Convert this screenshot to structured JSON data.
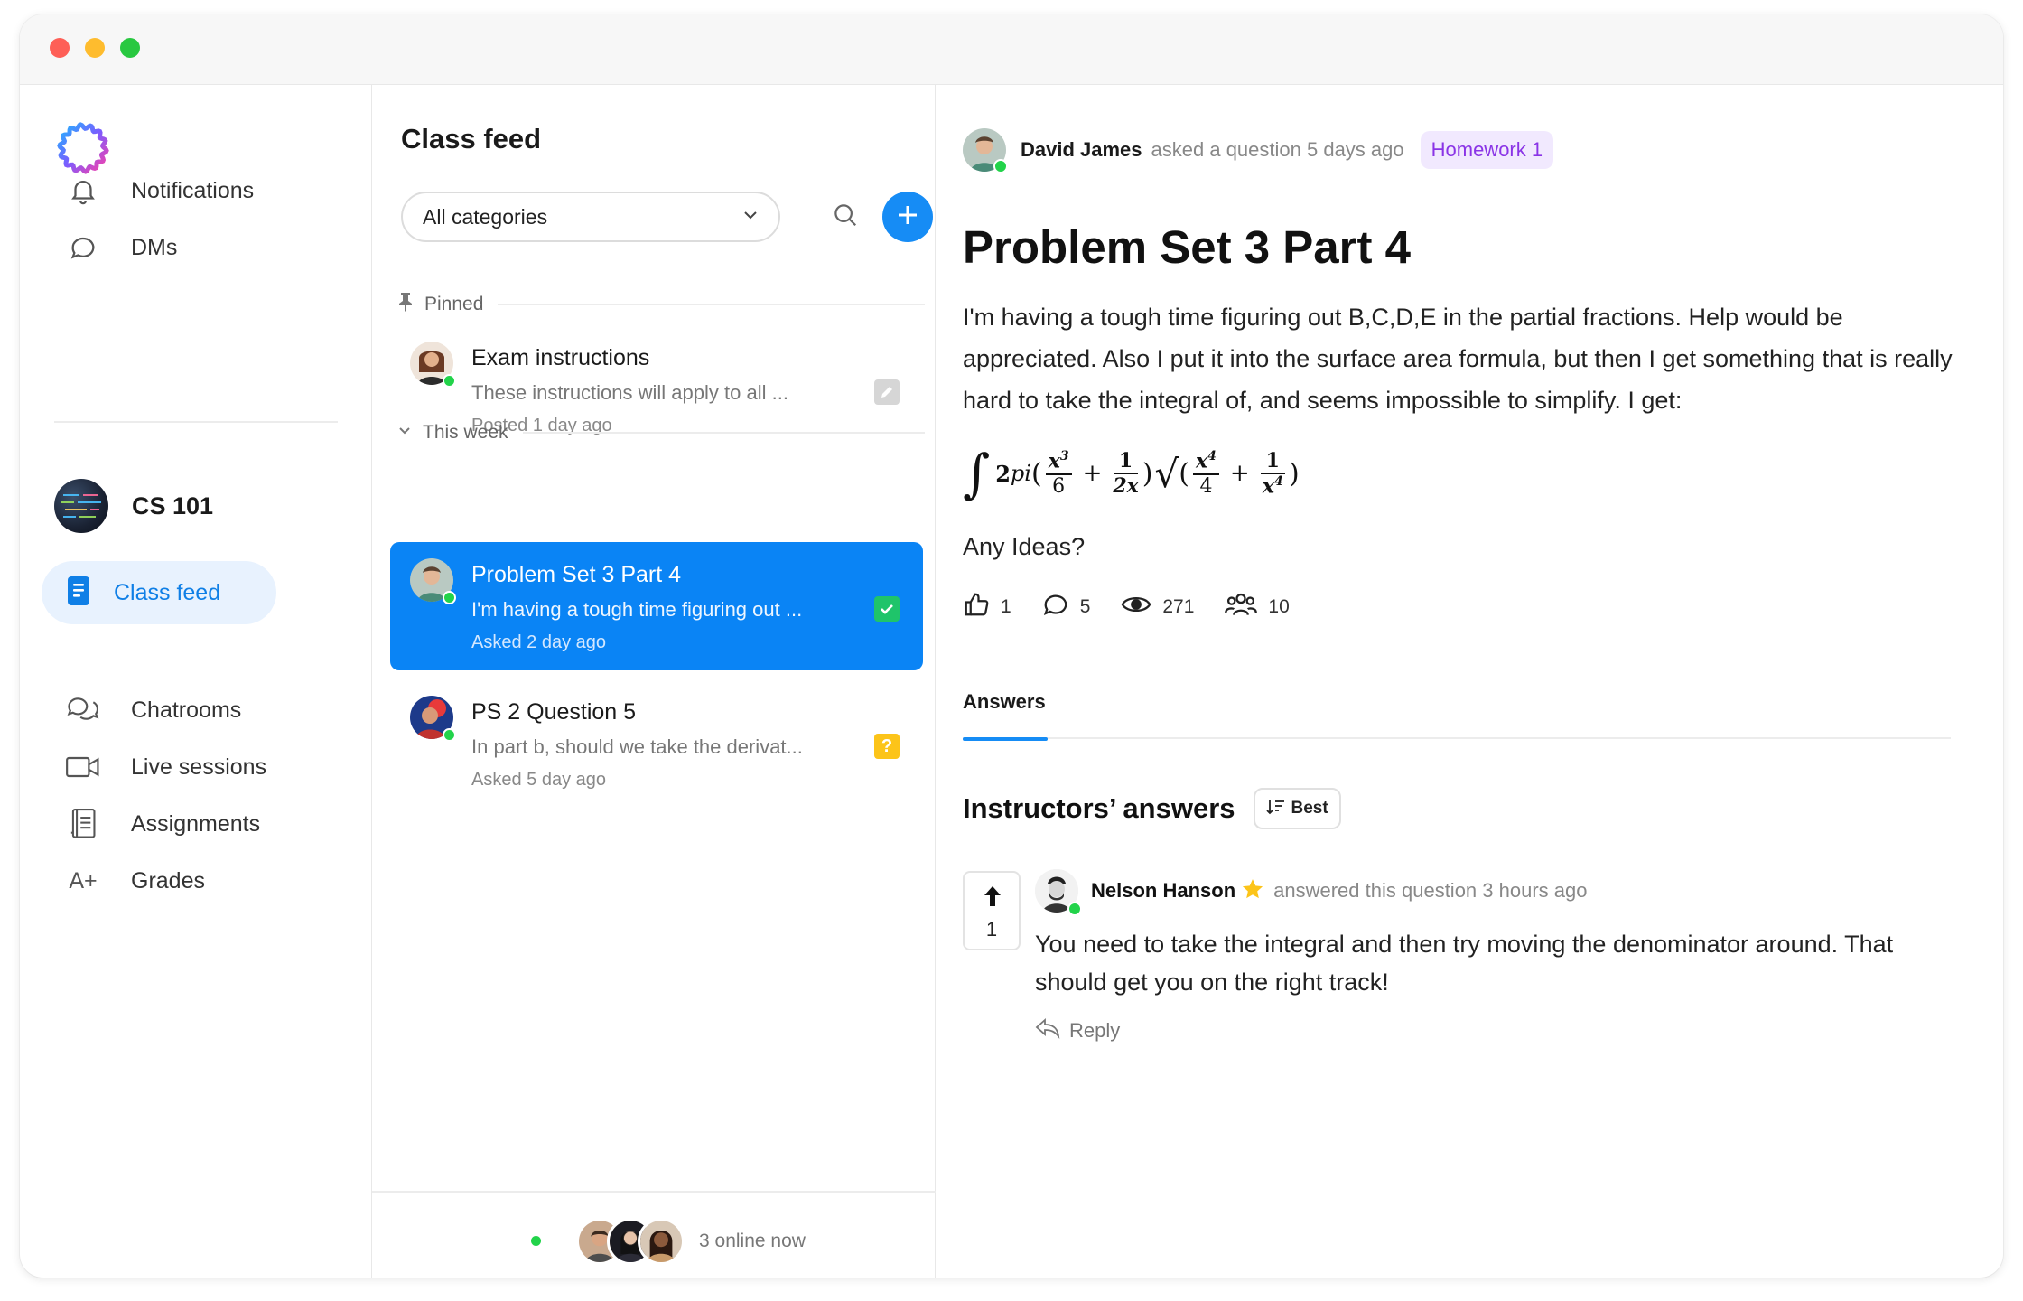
{
  "sidebar": {
    "nav_top": [
      {
        "label": "Notifications",
        "icon": "bell-icon"
      },
      {
        "label": "DMs",
        "icon": "chat-bubble-icon"
      }
    ],
    "course": {
      "label": "CS 101"
    },
    "active": {
      "label": "Class feed",
      "icon": "document-icon"
    },
    "nav_bottom": [
      {
        "label": "Chatrooms",
        "icon": "chatrooms-icon"
      },
      {
        "label": "Live sessions",
        "icon": "video-camera-icon"
      },
      {
        "label": "Assignments",
        "icon": "notebook-icon"
      },
      {
        "label": "Grades",
        "icon": "a-plus-icon",
        "glyph": "A+"
      }
    ]
  },
  "feed": {
    "title": "Class feed",
    "category_select": "All categories",
    "sections": {
      "pinned": "Pinned",
      "this_week": "This week"
    },
    "posts": [
      {
        "title": "Exam instructions",
        "preview": "These instructions will apply to all ...",
        "meta": "Posted 1 day ago",
        "status": "edit"
      },
      {
        "title": "Problem Set 3 Part 4",
        "preview": "I'm having a tough time figuring out ...",
        "meta": "Asked 2 day ago",
        "status": "answered"
      },
      {
        "title": "PS 2 Question 5",
        "preview": "In part b, should we take the derivat...",
        "meta": "Asked 5 day ago",
        "status": "question",
        "status_glyph": "?"
      }
    ],
    "online": "3 online now"
  },
  "question": {
    "author": "David James",
    "meta": "asked a question 5 days ago",
    "tag": "Homework 1",
    "title": "Problem Set 3 Part 4",
    "body": "I'm having a tough time figuring out B,C,D,E in the partial fractions. Help would be appreciated. Also I put it into the surface area formula, but then I get something that is really hard to take the integral of, and seems impossible to simplify. I get:",
    "formula": {
      "integral": "∫",
      "prefix": "2",
      "pi": "pi",
      "open1": "(",
      "f1_num": "x",
      "f1_num_exp": "3",
      "f1_den": "6",
      "plus": "+",
      "f2_num": "1",
      "f2_den": "2x",
      "close1": ")",
      "sqrt": "√",
      "open2": "(",
      "f3_num": "x",
      "f3_num_exp": "4",
      "f3_den": "4",
      "f4_num": "1",
      "f4_den": "x",
      "f4_den_exp": "4",
      "close2": ")"
    },
    "extra": "Any Ideas?",
    "stats": {
      "likes": "1",
      "comments": "5",
      "views": "271",
      "followers": "10"
    }
  },
  "tabs": {
    "answers": "Answers"
  },
  "answers": {
    "heading": "Instructors’ answers",
    "sort": "Best",
    "items": [
      {
        "votes": "1",
        "author": "Nelson Hanson",
        "meta": "answered this question 3 hours ago",
        "text": "You need to take the integral and then try moving the denominator around. That should get you on the right track!",
        "reply": "Reply"
      }
    ]
  },
  "colors": {
    "accent": "#0a84f5",
    "tag_bg": "#f1e9fe",
    "tag_text": "#8a34e6",
    "online": "#22d34a",
    "answered": "#1fc46a",
    "question": "#fcc419"
  }
}
